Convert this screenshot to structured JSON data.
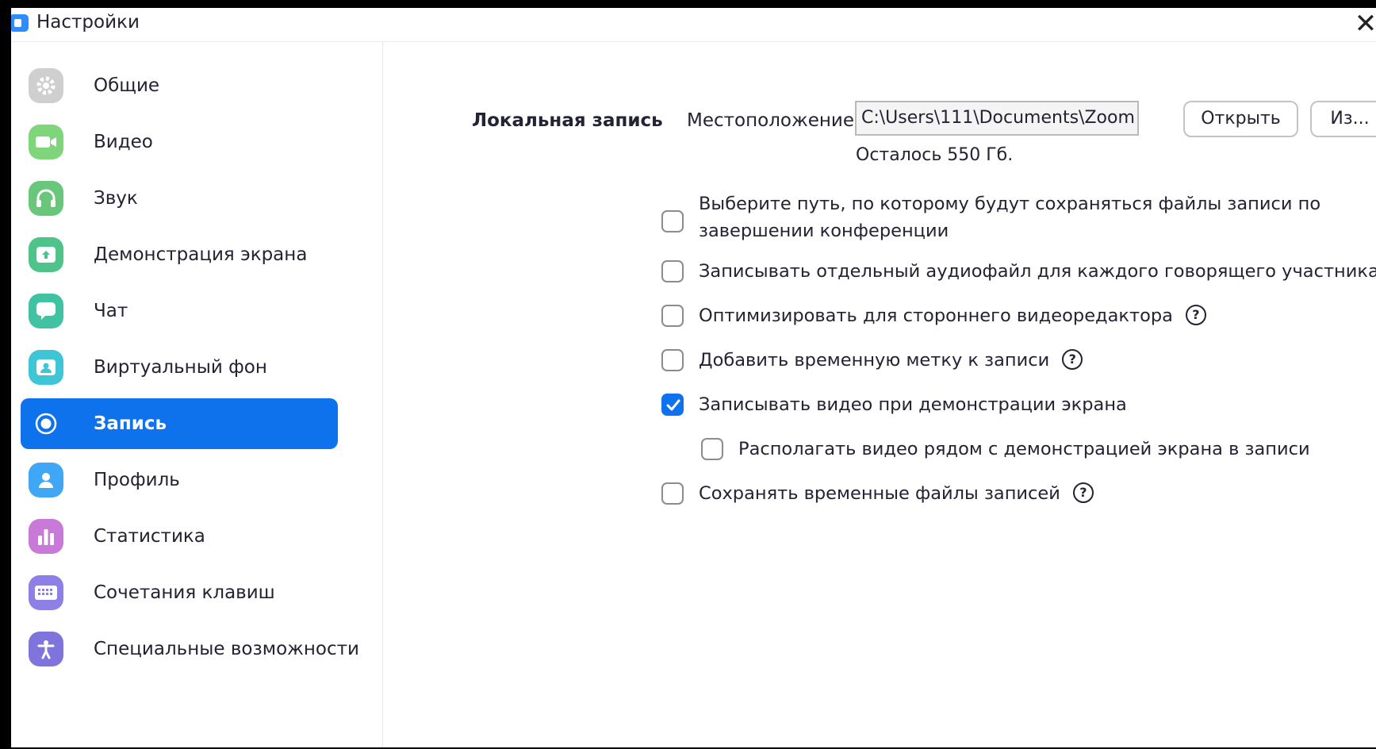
{
  "window": {
    "title": "Настройки",
    "close_glyph": "✕"
  },
  "sidebar": {
    "items": [
      {
        "label": "Общие",
        "icon": "gear-icon",
        "color": "#c8c8c8"
      },
      {
        "label": "Видео",
        "icon": "video-camera-icon",
        "color": "#7ed57a"
      },
      {
        "label": "Звук",
        "icon": "headphones-icon",
        "color": "#68c77a"
      },
      {
        "label": "Демонстрация экрана",
        "icon": "share-screen-icon",
        "color": "#4ec48a"
      },
      {
        "label": "Чат",
        "icon": "chat-bubble-icon",
        "color": "#41c3a3"
      },
      {
        "label": "Виртуальный фон",
        "icon": "virtual-background-icon",
        "color": "#3ec6d6"
      },
      {
        "label": "Запись",
        "icon": "record-icon",
        "color": "#0e72ed",
        "active": true
      },
      {
        "label": "Профиль",
        "icon": "profile-icon",
        "color": "#3fa7f5"
      },
      {
        "label": "Статистика",
        "icon": "statistics-icon",
        "color": "#c97ad8"
      },
      {
        "label": "Сочетания клавиш",
        "icon": "keyboard-icon",
        "color": "#8e7fe6"
      },
      {
        "label": "Специальные возможности",
        "icon": "accessibility-icon",
        "color": "#7e74dc"
      }
    ]
  },
  "recording": {
    "section_title": "Локальная запись",
    "location_label": "Местоположение:",
    "path_value": "C:\\Users\\111\\Documents\\Zoom",
    "open_button": "Открыть",
    "change_button": "Из...",
    "free_space": "Осталось 550 Гб.",
    "options": [
      {
        "line1": "Выберите путь, по которому будут сохраняться файлы записи по",
        "line2": "завершении конференции",
        "checked": false,
        "help": false
      },
      {
        "line1": "Записывать отдельный аудиофайл для каждого говорящего участника",
        "checked": false,
        "help": false
      },
      {
        "line1": "Оптимизировать для стороннего видеоредактора",
        "checked": false,
        "help": true
      },
      {
        "line1": "Добавить временную метку к записи",
        "checked": false,
        "help": true
      },
      {
        "line1": "Записывать видео при демонстрации экрана",
        "checked": true,
        "help": false
      },
      {
        "line1": "Располагать видео рядом с демонстрацией экрана в записи",
        "checked": false,
        "help": false,
        "indent": true
      },
      {
        "line1": "Сохранять временные файлы записей",
        "checked": false,
        "help": true
      }
    ],
    "help_glyph": "?"
  },
  "colors": {
    "accent": "#0e72ed",
    "text": "#232333"
  }
}
